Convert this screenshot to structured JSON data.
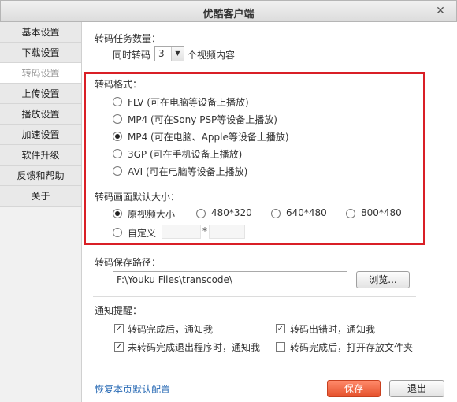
{
  "window": {
    "title": "优酷客户端"
  },
  "sidebar": {
    "items": [
      {
        "label": "基本设置"
      },
      {
        "label": "下载设置"
      },
      {
        "label": "转码设置"
      },
      {
        "label": "上传设置"
      },
      {
        "label": "播放设置"
      },
      {
        "label": "加速设置"
      },
      {
        "label": "软件升级"
      },
      {
        "label": "反馈和帮助"
      },
      {
        "label": "关于"
      }
    ],
    "active_index": 2
  },
  "task_count": {
    "label": "转码任务数量：",
    "prefix": "同时转码",
    "value": "3",
    "suffix": "个视频内容"
  },
  "format": {
    "label": "转码格式：",
    "options": [
      {
        "label": "FLV (可在电脑等设备上播放)",
        "selected": false
      },
      {
        "label": "MP4 (可在Sony PSP等设备上播放)",
        "selected": false
      },
      {
        "label": "MP4 (可在电脑、Apple等设备上播放)",
        "selected": true
      },
      {
        "label": "3GP (可在手机设备上播放)",
        "selected": false
      },
      {
        "label": "AVI (可在电脑等设备上播放)",
        "selected": false
      }
    ]
  },
  "size": {
    "label": "转码画面默认大小：",
    "options": [
      {
        "label": "原视频大小",
        "selected": true
      },
      {
        "label": "480*320",
        "selected": false
      },
      {
        "label": "640*480",
        "selected": false
      },
      {
        "label": "800*480",
        "selected": false
      }
    ],
    "custom_label": "自定义",
    "custom_separator": "*"
  },
  "save_path": {
    "label": "转码保存路径：",
    "value": "F:\\Youku Files\\transcode\\",
    "browse_label": "浏览..."
  },
  "notify": {
    "label": "通知提醒：",
    "options": [
      {
        "label": "转码完成后，通知我",
        "checked": true
      },
      {
        "label": "转码出错时，通知我",
        "checked": true
      },
      {
        "label": "未转码完成退出程序时，通知我",
        "checked": true
      },
      {
        "label": "转码完成后，打开存放文件夹",
        "checked": false
      }
    ]
  },
  "footer": {
    "restore_label": "恢复本页默认配置",
    "save_label": "保存",
    "exit_label": "退出"
  }
}
